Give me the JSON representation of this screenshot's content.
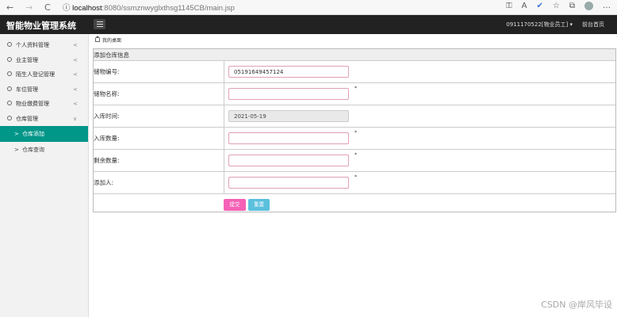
{
  "browser": {
    "back": "←",
    "forward": "→",
    "reload": "C",
    "info": "ⓘ",
    "url_host": "localhost",
    "url_path": ":8080/ssmznwyglxthsg1145CB/main.jsp"
  },
  "header": {
    "brand": "智能物业管理系统",
    "user": "0911170522[物业员工] ▾",
    "home_link": "前台首页"
  },
  "sidebar": {
    "items": [
      {
        "label": "个人资料管理",
        "chevron": "<"
      },
      {
        "label": "业主管理",
        "chevron": "<"
      },
      {
        "label": "陌生人登记管理",
        "chevron": "<"
      },
      {
        "label": "车位管理",
        "chevron": "<"
      },
      {
        "label": "物业缴费管理",
        "chevron": "<"
      },
      {
        "label": "仓库管理",
        "chevron": "∨"
      }
    ],
    "sub": [
      {
        "label": "仓库添加",
        "arrow": ">"
      },
      {
        "label": "仓库查询",
        "arrow": ">"
      }
    ]
  },
  "breadcrumb": "我的桌面",
  "form": {
    "title": "添加仓库信息",
    "fields": [
      {
        "label": "储物编号:",
        "value": "05191649457124",
        "required": ""
      },
      {
        "label": "储物名称:",
        "value": "",
        "required": "*"
      },
      {
        "label": "入库时间:",
        "value": "2021-05-19",
        "required": ""
      },
      {
        "label": "入库数量:",
        "value": "",
        "required": "*"
      },
      {
        "label": "剩余数量:",
        "value": "",
        "required": "*"
      },
      {
        "label": "添加人:",
        "value": "",
        "required": "*"
      }
    ],
    "submit": "提交",
    "reset": "重置"
  },
  "watermark": "CSDN @岸风毕设"
}
